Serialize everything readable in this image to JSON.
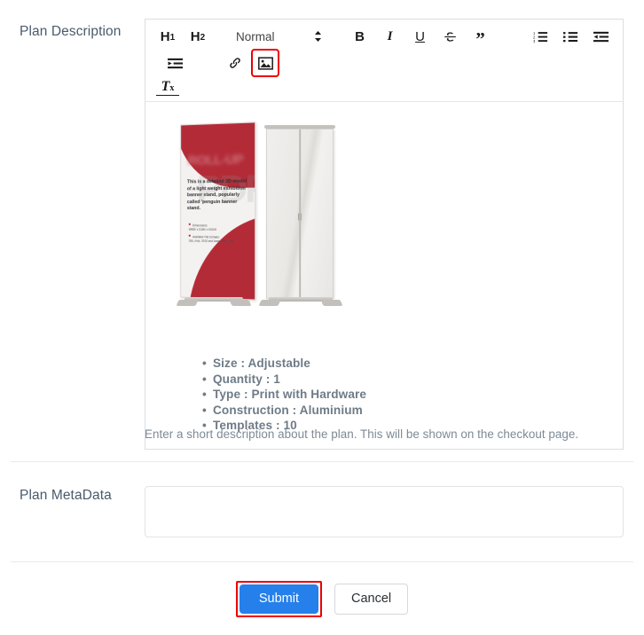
{
  "form": {
    "description_label": "Plan Description",
    "metadata_label": "Plan MetaData",
    "help_text": "Enter a short description about the plan. This will be shown on the checkout page.",
    "metadata_value": "",
    "metadata_placeholder": ""
  },
  "toolbar": {
    "h1_label": "H",
    "h1_sub": "1",
    "h2_label": "H",
    "h2_sub": "2",
    "clear_format_label": "T",
    "clear_format_sub": "x",
    "format_selected": "Normal",
    "bold_label": "B",
    "italic_label": "I",
    "underline_label": "U",
    "strike_label": "S",
    "blockquote_label": "”",
    "items": [
      {
        "name": "header-1-button",
        "label": "H1"
      },
      {
        "name": "header-2-button",
        "label": "H2"
      },
      {
        "name": "format-picker",
        "label": "Normal"
      },
      {
        "name": "bold-button",
        "label": "B"
      },
      {
        "name": "italic-button",
        "label": "I"
      },
      {
        "name": "underline-button",
        "label": "U"
      },
      {
        "name": "strikethrough-button",
        "label": "S"
      },
      {
        "name": "blockquote-button",
        "label": "”"
      },
      {
        "name": "ordered-list-button",
        "label": "Ordered list"
      },
      {
        "name": "bullet-list-button",
        "label": "Bullet list"
      },
      {
        "name": "outdent-button",
        "label": "Outdent"
      },
      {
        "name": "indent-button",
        "label": "Indent"
      },
      {
        "name": "link-button",
        "label": "Link"
      },
      {
        "name": "image-button",
        "label": "Image"
      },
      {
        "name": "clear-format-button",
        "label": "Tx"
      }
    ],
    "highlight_color": "#ee0000"
  },
  "editor_content": {
    "image": {
      "alt": "Roll-up penguin banner stand product photo",
      "banner_headline": "ROLL-UP",
      "banner_watermark": "PDF",
      "banner_copy": "This is a detailed 3D model of a light weight exhibition banner stand, popularly called 'penguin banner stand.",
      "banner_spec_1_title": "Dimensions:",
      "banner_spec_1_value": "W850 x D180 x H2100",
      "banner_spec_2_title": "Available File formats:",
      "banner_spec_2_value": "3ds, max, 2010 and lower, FBX , obj"
    },
    "specs": [
      "Size : Adjustable",
      "Quantity : 1",
      "Type : Print with Hardware",
      "Construction : Aluminium",
      "Templates : 10"
    ]
  },
  "footer": {
    "submit_label": "Submit",
    "cancel_label": "Cancel",
    "submit_color": "#2680eb",
    "highlight_color": "#ee0000"
  }
}
